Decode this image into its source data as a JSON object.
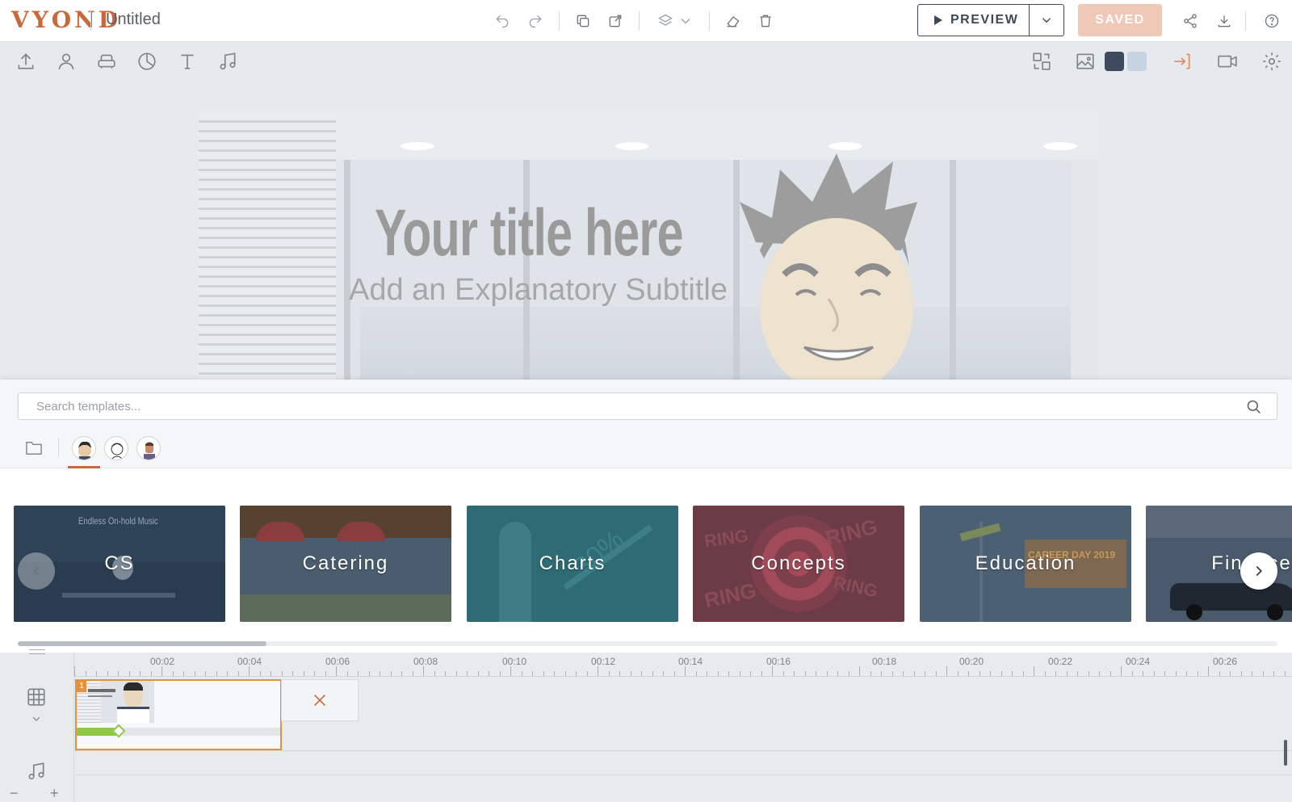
{
  "app": {
    "logo_text": "VYOND",
    "doc_title": "Untitled"
  },
  "header": {
    "preview_label": "PREVIEW",
    "saved_label": "SAVED"
  },
  "toolbar_icons": [
    "upload-icon",
    "character-icon",
    "prop-icon",
    "chart-icon",
    "text-icon",
    "music-icon"
  ],
  "stage": {
    "title": "Your title here",
    "subtitle": "Add an Explanatory Subtitle"
  },
  "colors": {
    "accent": "#c9683a",
    "swatch_dark": "#3f4a5e",
    "swatch_light": "#c7d2e2",
    "scene_border": "#e0923c",
    "progress_green": "#8fc64b"
  },
  "templates": {
    "search_placeholder": "Search templates...",
    "cards": [
      {
        "label": "CS",
        "bg": "#2f4358"
      },
      {
        "label": "Catering",
        "bg": "#4a5d6e"
      },
      {
        "label": "Charts",
        "bg": "#2e6b74"
      },
      {
        "label": "Concepts",
        "bg": "#6b3b46"
      },
      {
        "label": "Education",
        "bg": "#4c6074"
      },
      {
        "label": "Finance",
        "bg": "#4a5a6c"
      }
    ],
    "cs_caption": "Endless On-hold Music",
    "charts_badge": "30%",
    "concepts_words": [
      "RING",
      "RING",
      "RING",
      "RING"
    ],
    "education_poster": "CAREER DAY 2019"
  },
  "timeline": {
    "ticks": [
      "00:02",
      "00:04",
      "00:06",
      "00:08",
      "00:10",
      "00:12",
      "00:14",
      "00:16",
      "00:18",
      "00:20",
      "00:22",
      "00:24",
      "00:26"
    ],
    "scene_number": "1",
    "zoom_out": "−",
    "zoom_in": "+"
  }
}
